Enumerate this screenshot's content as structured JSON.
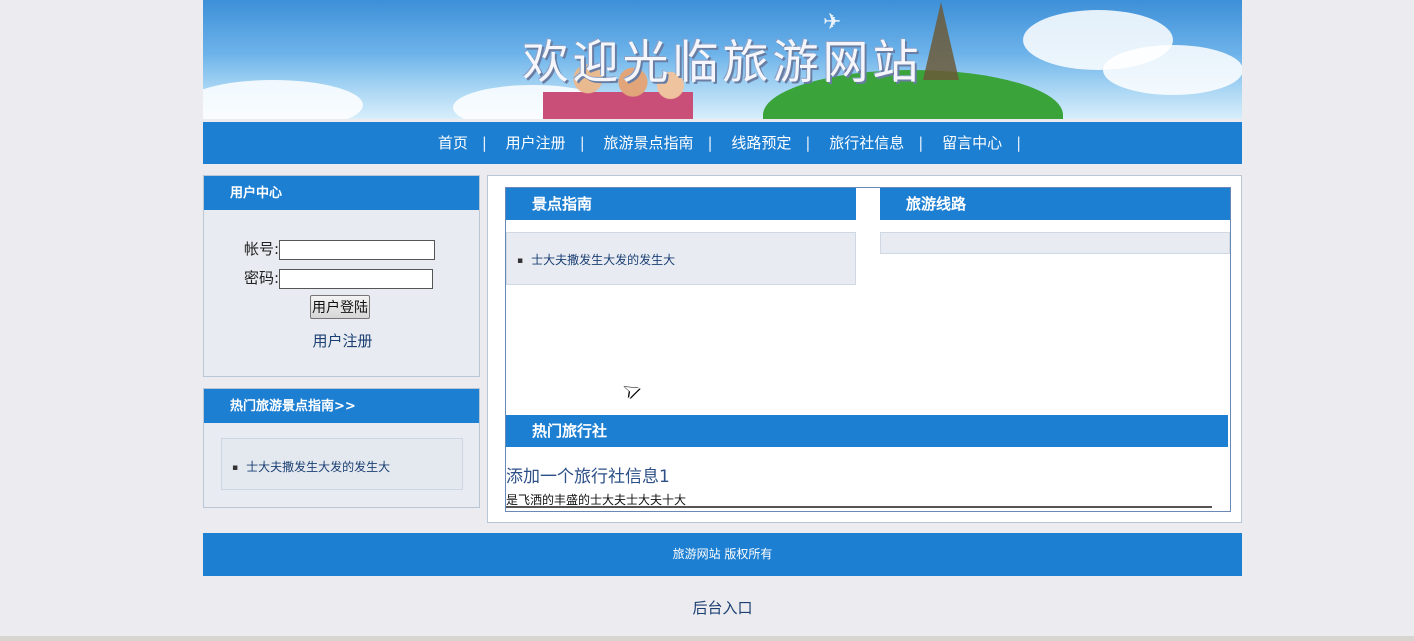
{
  "banner": {
    "title": "欢迎光临旅游网站"
  },
  "nav": {
    "items": [
      "首页",
      "用户注册",
      "旅游景点指南",
      "线路预定",
      "旅行社信息",
      "留言中心"
    ],
    "separator": "|"
  },
  "user_center": {
    "title": "用户中心",
    "account_label": "帐号:",
    "password_label": "密码:",
    "account_value": "",
    "password_value": "",
    "login_button": "用户登陆",
    "register_link": "用户注册"
  },
  "hot_spots": {
    "title": "热门旅游景点指南>>",
    "items": [
      "士大夫撒发生大发的发生大"
    ]
  },
  "scenic_guide": {
    "title": "景点指南",
    "items": [
      "士大夫撒发生大发的发生大"
    ]
  },
  "travel_routes": {
    "title": "旅游线路"
  },
  "hot_agencies": {
    "title": "热门旅行社",
    "agency_title": "添加一个旅行社信息1",
    "agency_desc": "是飞洒的丰盛的士大夫士大夫十大"
  },
  "footer": {
    "copyright": "旅游网站 版权所有"
  },
  "admin_link": "后台入口",
  "colors": {
    "accent": "#1d7fd2",
    "page_bg": "#ecebef",
    "panel_bg": "#e8ecf2"
  }
}
